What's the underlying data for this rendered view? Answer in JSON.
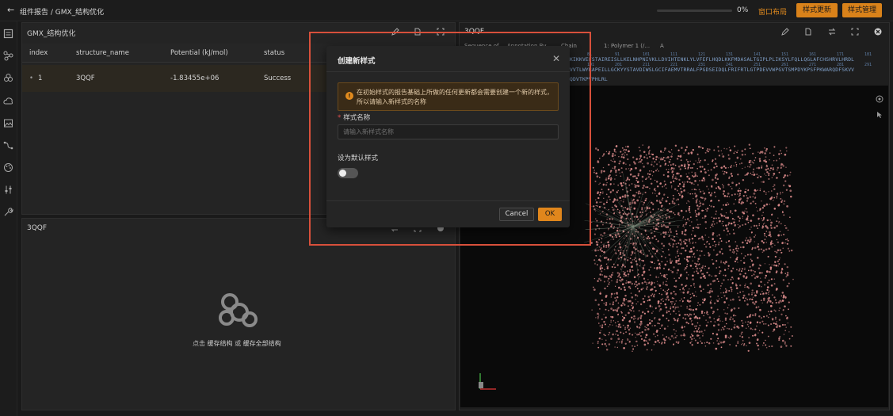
{
  "topbar": {
    "breadcrumb": "组件报告 / GMX_结构优化",
    "progress_value": 0,
    "progress_label": "0%",
    "layout_link": "窗口布局",
    "update_style_button": "样式更新",
    "manage_style_button": "样式管理"
  },
  "sidebar": {
    "icons": [
      "list-icon",
      "network-icon",
      "cluster-icon",
      "cloud-icon",
      "image-icon",
      "route-icon",
      "palette-icon",
      "sliders-icon",
      "wrench-icon"
    ]
  },
  "table_panel": {
    "title": "GMX_结构优化",
    "columns": [
      "index",
      "structure_name",
      "Potential (kJ/mol)",
      "status"
    ],
    "rows": [
      {
        "index": "1",
        "structure_name": "3QQF",
        "potential": "-1.83455e+06",
        "status": "Success"
      }
    ]
  },
  "structure_panel": {
    "title": "3QQF",
    "empty_hint_prefix": "点击",
    "empty_hint_link1": "缓存结构",
    "empty_hint_or": "或",
    "empty_hint_link2": "缓存全部结构"
  },
  "viewer_panel": {
    "title": "3QQF",
    "seq_tabs": [
      "Sequence of",
      "Annotation By",
      "Chain",
      "1: Polymer 1 (/...",
      "A"
    ],
    "seq_line1": "LKKIKKVEFSTAIREISLLKELNHPNIVKLLDVIHTENKLYLVFEFLHQDLKKFMDASALTGIPLPLIKSYLFQLLQGLAFCHSHRVLHRDL",
    "seq_line2": "PEVVTLWYRAPEILLGCKYYSTAVDIWSLGCIFAEMVTRRALFPGDSEIDQLFRIFRTLGTPDEVVWPGVTSMPDYKPSFPKWARQDFSKVV",
    "seq_line3": "FFQDVTKPVPHLRL",
    "seq_numbers": [
      "81",
      "91",
      "101",
      "111",
      "121",
      "131",
      "141",
      "151",
      "161",
      "171",
      "181",
      "191",
      "201",
      "211",
      "221",
      "231",
      "241",
      "251",
      "261",
      "271",
      "281",
      "291"
    ]
  },
  "modal": {
    "title": "创建新样式",
    "alert_text": "在初始样式的报告基础上所做的任何更新都会需要创建一个新的样式，所以请输入新样式的名称",
    "field_label": "样式名称",
    "field_placeholder": "请输入新样式名称",
    "field_value": "",
    "default_label": "设为默认样式",
    "default_toggle_on": false,
    "cancel_label": "Cancel",
    "ok_label": "OK"
  },
  "colors": {
    "accent": "#e08a1e",
    "highlight_border": "#d8503b",
    "molecule": "#d98a8a"
  }
}
